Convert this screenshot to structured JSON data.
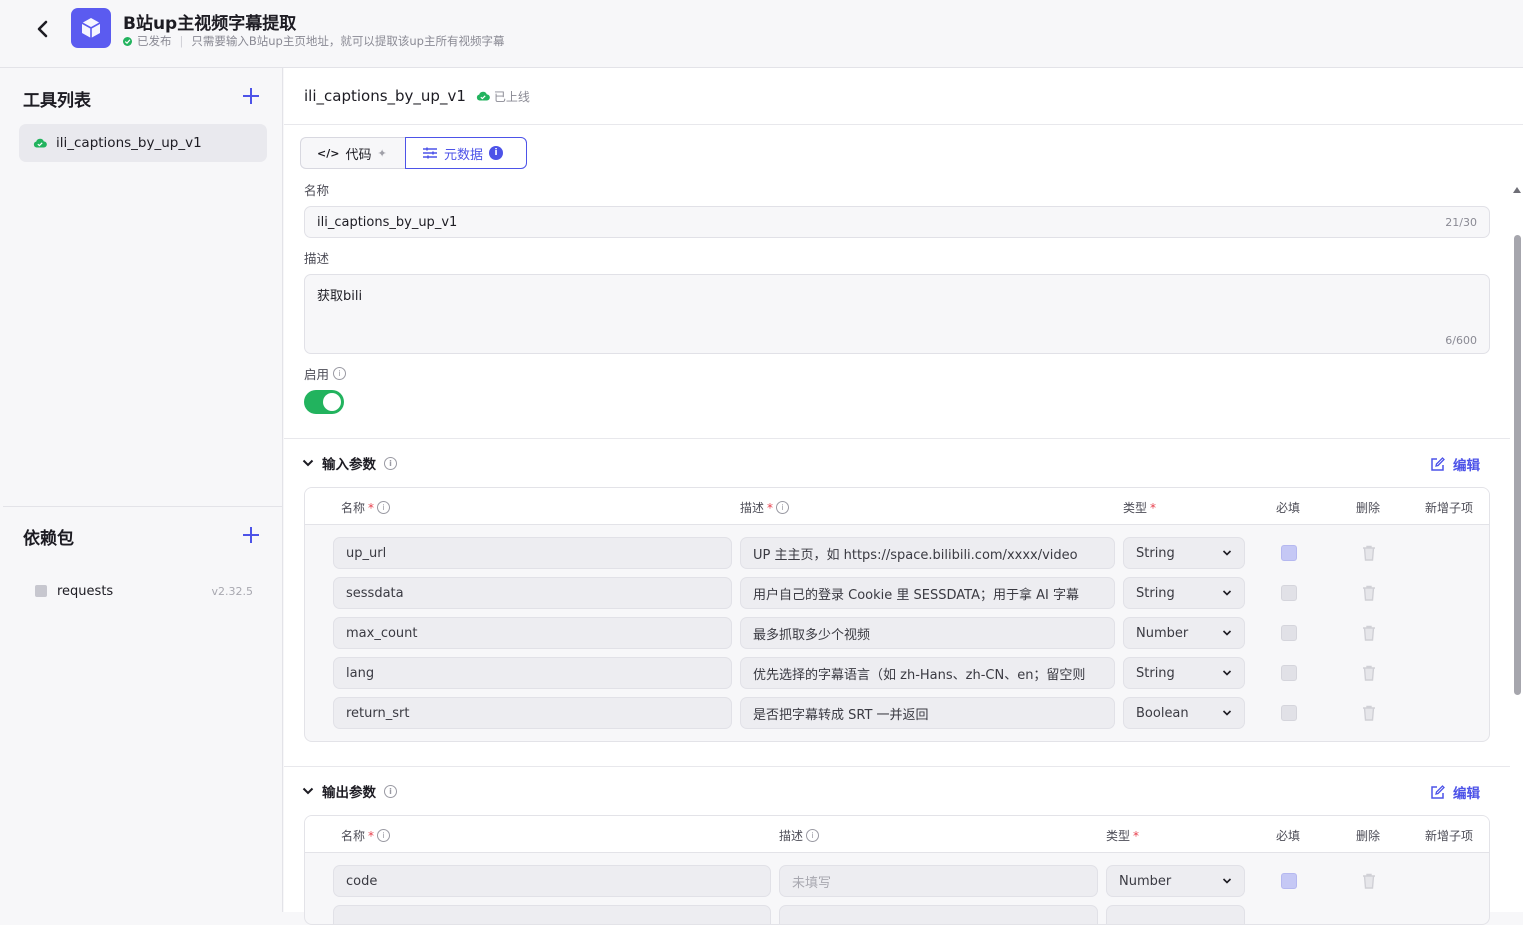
{
  "header": {
    "title": "B站up主视频字幕提取",
    "status": "已发布",
    "subtitle": "只需要输入B站up主页地址，就可以提取该up主所有视频字幕"
  },
  "sidebar": {
    "tools_title": "工具列表",
    "tools": [
      {
        "label": "ili_captions_by_up_v1"
      }
    ],
    "deps_title": "依赖包",
    "deps": [
      {
        "name": "requests",
        "version": "v2.32.5"
      }
    ]
  },
  "main": {
    "tool_name": "ili_captions_by_up_v1",
    "online_label": "已上线",
    "tabs": [
      {
        "label": "代码"
      },
      {
        "label": "元数据"
      }
    ],
    "name_label": "名称",
    "name_value": "ili_captions_by_up_v1",
    "name_counter": "21/30",
    "desc_label": "描述",
    "desc_value": "获取bili",
    "desc_counter": "6/600",
    "enable_label": "启用",
    "enabled": true
  },
  "input_params": {
    "title": "输入参数",
    "edit_label": "编辑",
    "headers": {
      "name": "名称",
      "desc": "描述",
      "type": "类型",
      "required": "必填",
      "delete": "删除",
      "add_child": "新增子项"
    },
    "rows": [
      {
        "name": "up_url",
        "desc": "UP 主主页，如 https://space.bilibili.com/xxxx/video",
        "type": "String",
        "required": true
      },
      {
        "name": "sessdata",
        "desc": "用户自己的登录 Cookie 里 SESSDATA；用于拿 AI 字幕",
        "type": "String",
        "required": false
      },
      {
        "name": "max_count",
        "desc": "最多抓取多少个视频",
        "type": "Number",
        "required": false
      },
      {
        "name": "lang",
        "desc": "优先选择的字幕语言（如 zh-Hans、zh-CN、en；留空则",
        "type": "String",
        "required": false
      },
      {
        "name": "return_srt",
        "desc": "是否把字幕转成 SRT 一并返回",
        "type": "Boolean",
        "required": false
      }
    ]
  },
  "output_params": {
    "title": "输出参数",
    "edit_label": "编辑",
    "headers": {
      "name": "名称",
      "desc": "描述",
      "type": "类型",
      "required": "必填",
      "delete": "删除",
      "add_child": "新增子项"
    },
    "rows": [
      {
        "name": "code",
        "desc_placeholder": "未填写",
        "type": "Number",
        "required": true
      }
    ]
  },
  "colors": {
    "accent": "#4d53e8",
    "success": "#22b35e",
    "required": "#e8404d"
  }
}
